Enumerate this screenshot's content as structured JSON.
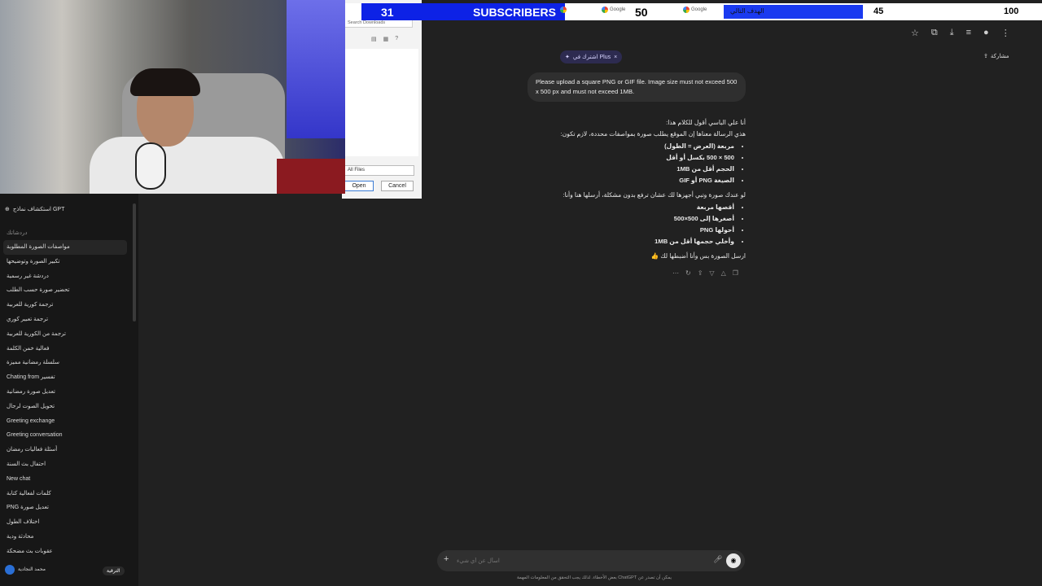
{
  "sidebar": {
    "explore_label": "استكشاف نماذج GPT",
    "section_label": "دردشاتك",
    "chats": [
      "مواصفات الصورة المطلوبة",
      "تكبير الصورة وتوضيحها",
      "دردشة غير رسمية",
      "تحضير صورة حسب الطلب",
      "ترجمة كورية للعربية",
      "ترجمة تعبير كوري",
      "ترجمة من الكورية للعربية",
      "فعالية خمن الكلمة",
      "سلسلة رمضانية مميزة",
      "Chating from تفسير",
      "تعديل صورة رمضانية",
      "تحويل الصوت لرجال",
      "Greeting exchange",
      "Greeting conversation",
      "أسئلة فعاليات رمضان",
      "احتفال بث السنة",
      "New chat",
      "كلمات لفعالية كتابة",
      "PNG تعديل صورة",
      "اختلاف الطول",
      "محادثة ودية",
      "عقوبات بث مضحكة"
    ],
    "user_name": "محمد النجادية",
    "upgrade_label": "الترقية"
  },
  "topbar": {
    "share_label": "مشاركة"
  },
  "plus_pill": {
    "label": "اشترك في Plus"
  },
  "user_message": "Please upload a square PNG or GIF file. Image size must not exceed 500 x 500 px and must not exceed 1MB.",
  "assistant": {
    "line1": "أنا علي الباسي أقول للكلام هذا:",
    "line2": "هذي الرسالة معناها إن الموقع يطلب صورة بمواصفات محددة، لازم تكون:",
    "specs": [
      "مربعة (العرض = الطول)",
      "500 × 500 بكسل أو أقل",
      "الحجم أقل من 1MB",
      "الصيغة PNG أو GIF"
    ],
    "line3": "لو عندك صورة وتبي أجهزها لك عشان ترفع بدون مشكلة، أرسلها هنا وأنا:",
    "steps": [
      "أقصها مربعة",
      "أصغرها إلى 500×500",
      "أحولها PNG",
      "وأخلي حجمها أقل من 1MB"
    ],
    "line4": "ارسل الصورة بس وأنا أضبطها لك 👍"
  },
  "composer": {
    "placeholder": "اسأل عن أي شيء",
    "disclaimer": "بعض الأخطاء. لذلك يجب التحقق من المعلومات المهمة ChatGPT يمكن أن تصدر عن"
  },
  "file_dialog": {
    "search_placeholder": "Search Downloads",
    "file_type": "All Files",
    "open_label": "Open",
    "cancel_label": "Cancel"
  },
  "banner": {
    "count_left": "31",
    "title": "SUBSCRIBERS",
    "count_mid": "50",
    "google_labels": [
      "Google",
      "Google",
      "Google"
    ],
    "goal_label": "الهدف التالي",
    "goal_current": "45",
    "goal_target": "100",
    "goal_progress": 0.45
  },
  "colors": {
    "banner_blue": "#0d22e6",
    "plus_pill_bg": "#2d2b50"
  },
  "icons": {
    "star": "star-icon",
    "extensions": "puzzle-icon",
    "download": "download-icon",
    "menu": "menu-icon",
    "share": "share-icon",
    "voice": "voice-icon",
    "mic": "mic-icon"
  }
}
